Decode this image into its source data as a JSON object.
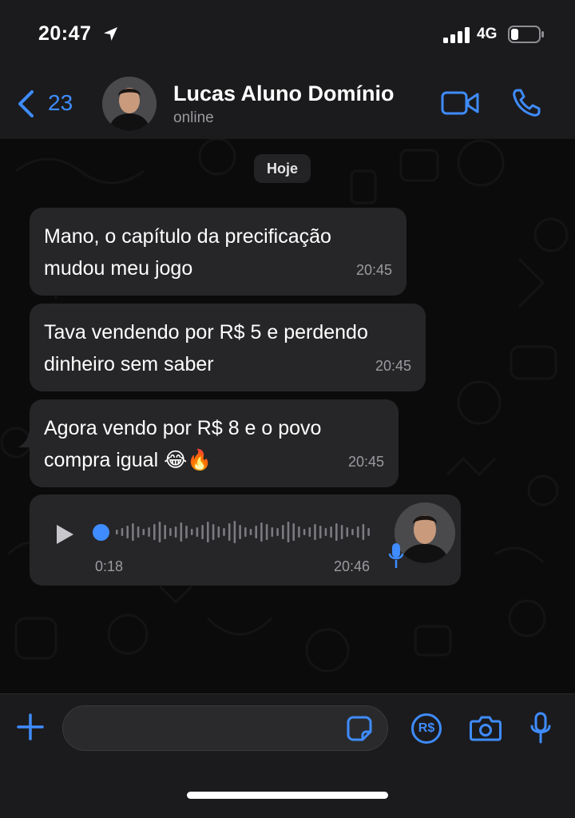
{
  "status_bar": {
    "time": "20:47",
    "network": "4G",
    "icons": [
      "location-arrow-icon",
      "signal-icon",
      "battery-icon"
    ]
  },
  "header": {
    "back_count": "23",
    "contact_name": "Lucas Aluno Domínio",
    "contact_status": "online",
    "icons": [
      "chevron-left-icon",
      "video-camera-icon",
      "phone-icon"
    ]
  },
  "chat": {
    "date_label": "Hoje",
    "messages": [
      {
        "text": "Mano, o capítulo da precificação\nmudou meu jogo",
        "time": "20:45"
      },
      {
        "text": "Tava vendendo por R$ 5 e perdendo\ndinheiro sem saber",
        "time": "20:45"
      },
      {
        "text": "Agora vendo por R$ 8 e o povo\ncompra igual 😂🔥",
        "time": "20:45"
      }
    ],
    "voice_note": {
      "duration": "0:18",
      "time": "20:46",
      "progress": 0
    }
  },
  "composer": {
    "input_value": "",
    "pay_label": "R$",
    "icons": [
      "plus-icon",
      "sticker-icon",
      "payment-icon",
      "camera-icon",
      "microphone-icon"
    ]
  },
  "colors": {
    "accent": "#3f8cff",
    "bubble": "#262628",
    "header_bg": "#1b1b1d",
    "chat_bg": "#0b0b0b",
    "secondary_text": "#9b9ba0"
  }
}
